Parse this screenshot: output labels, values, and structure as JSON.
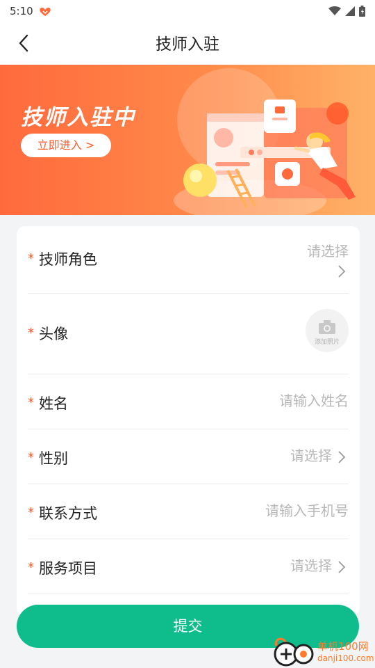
{
  "status": {
    "time": "5:10",
    "app_icon": "heart-hands-icon",
    "wifi": "wifi-icon",
    "signal": "signal-icon",
    "battery": "battery-icon"
  },
  "nav": {
    "title": "技师入驻",
    "back_icon": "back-arrow-icon"
  },
  "banner": {
    "title": "技师入驻中",
    "button": "立即进入 >"
  },
  "form": {
    "required_mark": "*",
    "role": {
      "label": "技师角色",
      "value": "请选择"
    },
    "avatar": {
      "label": "头像",
      "caption": "添加照片"
    },
    "name": {
      "label": "姓名",
      "placeholder": "请输入姓名"
    },
    "gender": {
      "label": "性别",
      "value": "请选择"
    },
    "contact": {
      "label": "联系方式",
      "placeholder": "请输入手机号"
    },
    "service": {
      "label": "服务项目",
      "value": "请选择"
    }
  },
  "submit_label": "提交",
  "watermark": {
    "name": "单机100网",
    "url": "danji100.com"
  },
  "colors": {
    "accent": "#0fbd8c",
    "required": "#ff5a2a",
    "banner_start": "#ff6a3d",
    "banner_end": "#ffb268"
  }
}
